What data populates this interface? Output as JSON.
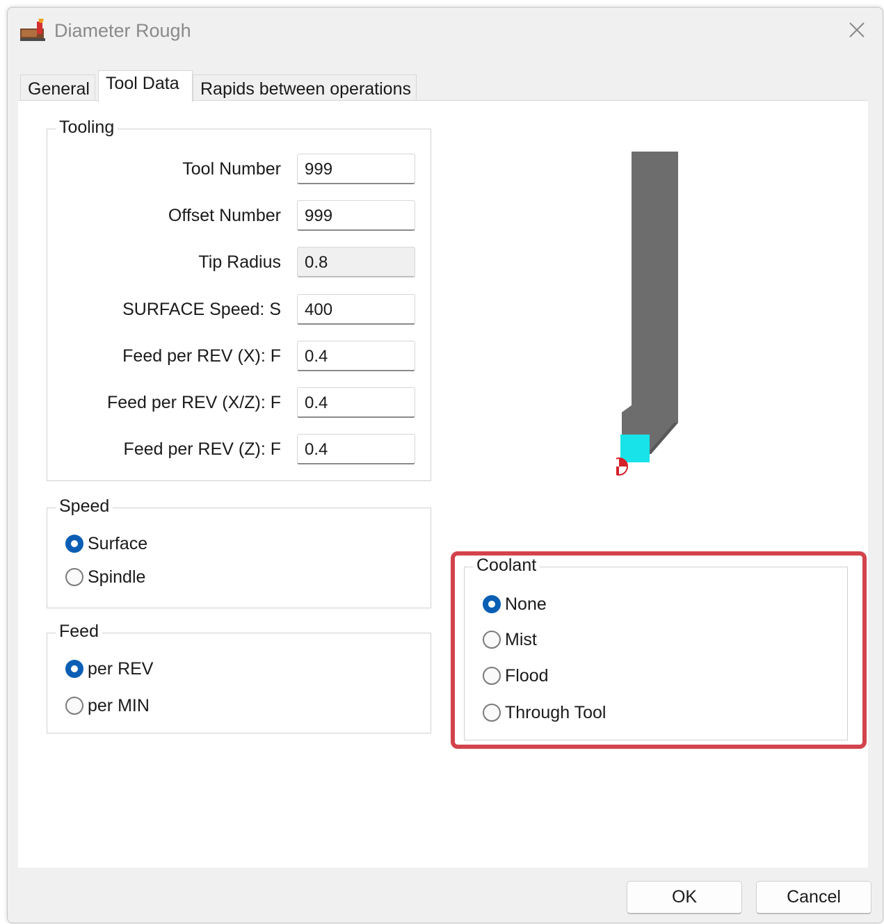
{
  "window": {
    "title": "Diameter Rough"
  },
  "tabs": [
    {
      "label": "General"
    },
    {
      "label": "Tool Data"
    },
    {
      "label": "Rapids between operations"
    }
  ],
  "tooling": {
    "label": "Tooling",
    "fields": [
      {
        "label": "Tool Number",
        "value": "999"
      },
      {
        "label": "Offset Number",
        "value": "999"
      },
      {
        "label": "Tip Radius",
        "value": "0.8"
      },
      {
        "label": "SURFACE Speed: S",
        "value": "400"
      },
      {
        "label": "Feed per REV (X): F",
        "value": "0.4"
      },
      {
        "label": "Feed per REV (X/Z): F",
        "value": "0.4"
      },
      {
        "label": "Feed per REV (Z): F",
        "value": "0.4"
      }
    ]
  },
  "speed": {
    "label": "Speed",
    "options": [
      {
        "label": "Surface",
        "checked": true
      },
      {
        "label": "Spindle",
        "checked": false
      }
    ]
  },
  "feed": {
    "label": "Feed",
    "options": [
      {
        "label": "per REV",
        "checked": true
      },
      {
        "label": "per MIN",
        "checked": false
      }
    ]
  },
  "coolant": {
    "label": "Coolant",
    "options": [
      {
        "label": "None",
        "checked": true
      },
      {
        "label": "Mist",
        "checked": false
      },
      {
        "label": "Flood",
        "checked": false
      },
      {
        "label": "Through Tool",
        "checked": false
      }
    ]
  },
  "buttons": {
    "ok": "OK",
    "cancel": "Cancel"
  },
  "colors": {
    "accent": "#0a5fb4",
    "highlight": "#d2434b",
    "tool_body": "#6d6d6d",
    "tool_insert": "#17e3e8",
    "tool_tip_marker": "#d4232b"
  },
  "icons": {
    "app": "lathe-tool-icon",
    "close": "close-icon"
  }
}
